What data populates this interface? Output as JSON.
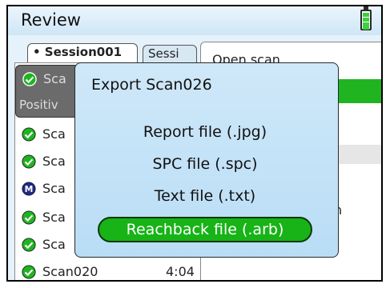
{
  "app": {
    "title": "Review"
  },
  "tabs": [
    {
      "label": "• Session001"
    },
    {
      "label": "Sessi"
    }
  ],
  "scan_list": [
    {
      "name": "Sca",
      "time": "",
      "status": "check",
      "subtext": "Positiv"
    },
    {
      "name": "Sca",
      "time": "",
      "status": "check"
    },
    {
      "name": "Sca",
      "time": "",
      "status": "check"
    },
    {
      "name": "Sca",
      "time": "",
      "status": "mixed"
    },
    {
      "name": "Sca",
      "time": "",
      "status": "check"
    },
    {
      "name": "Sca",
      "time": "",
      "status": "check"
    },
    {
      "name": "Scan020",
      "time": "4:04",
      "status": "check"
    }
  ],
  "right_pane": {
    "header": "Open scan",
    "partial_text": "n"
  },
  "dialog": {
    "title": "Export Scan026",
    "options": [
      {
        "label": "Report file (.jpg)",
        "selected": false
      },
      {
        "label": "SPC file (.spc)",
        "selected": false
      },
      {
        "label": "Text file (.txt)",
        "selected": false
      },
      {
        "label": "Reachback file (.arb)",
        "selected": true
      }
    ]
  },
  "colors": {
    "check_green": "#21b421",
    "mixed_blue": "#1b2a8a",
    "dialog_bg": "#c3e2f7",
    "selected_option": "#17b317"
  },
  "icons": {
    "check": "check-circle-icon",
    "mixed": "m-circle-icon",
    "battery": "battery-full-icon"
  }
}
